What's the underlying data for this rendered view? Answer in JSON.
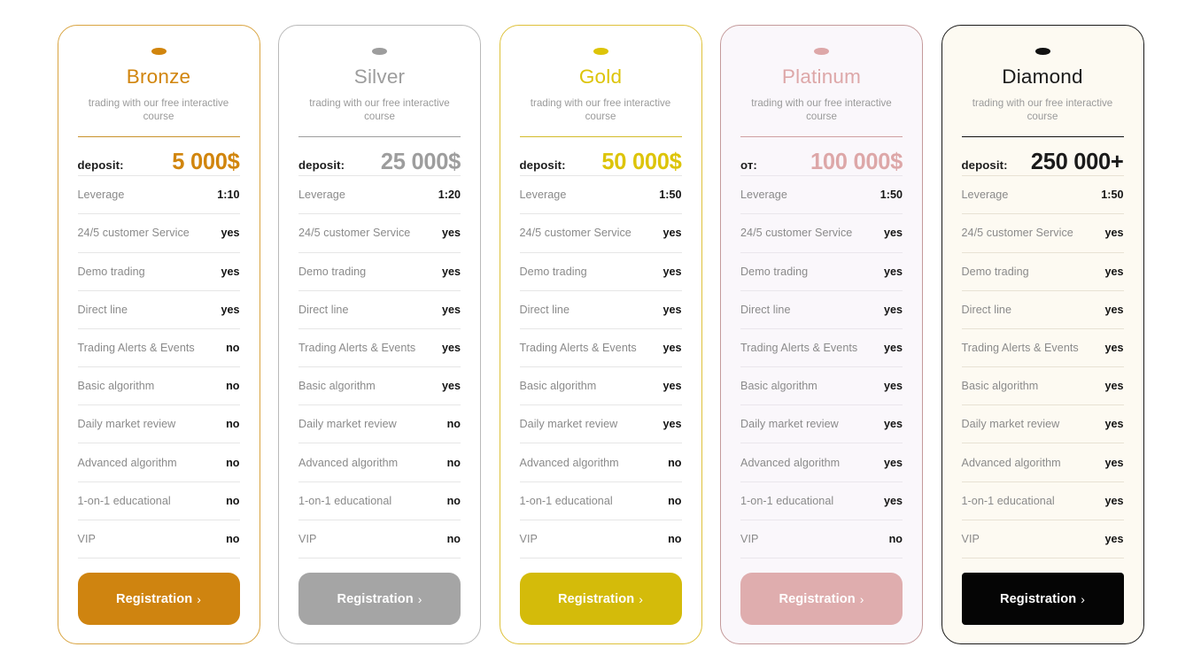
{
  "feature_labels": [
    "Leverage",
    "24/5 customer Service",
    "Demo trading",
    "Direct line",
    "Trading Alerts & Events",
    "Basic algorithm",
    "Daily market review",
    "Advanced algorithm",
    "1-on-1 educational",
    "VIP"
  ],
  "cta": {
    "label": "Registration",
    "chevron": "›",
    "chevron_icon_name": "chevron-right-icon"
  },
  "plans": [
    {
      "id": "bronze",
      "name": "Bronze",
      "tagline": "trading with our free interactive course",
      "accent": "#d1850d",
      "deposit_label": "deposit:",
      "deposit_value": "5 000$",
      "features": [
        "1:10",
        "yes",
        "yes",
        "yes",
        "no",
        "no",
        "no",
        "no",
        "no",
        "no"
      ]
    },
    {
      "id": "silver",
      "name": "Silver",
      "tagline": "trading with our free interactive course",
      "accent": "#9d9d9d",
      "deposit_label": "deposit:",
      "deposit_value": "25 000$",
      "features": [
        "1:20",
        "yes",
        "yes",
        "yes",
        "yes",
        "yes",
        "no",
        "no",
        "no",
        "no"
      ]
    },
    {
      "id": "gold",
      "name": "Gold",
      "tagline": "trading with our free interactive course",
      "accent": "#ddc409",
      "deposit_label": "deposit:",
      "deposit_value": "50 000$",
      "features": [
        "1:50",
        "yes",
        "yes",
        "yes",
        "yes",
        "yes",
        "yes",
        "no",
        "no",
        "no"
      ]
    },
    {
      "id": "platinum",
      "name": "Platinum",
      "tagline": "trading with our free interactive course",
      "accent": "#dda7a8",
      "deposit_label": "от:",
      "deposit_value": "100 000$",
      "features": [
        "1:50",
        "yes",
        "yes",
        "yes",
        "yes",
        "yes",
        "yes",
        "yes",
        "yes",
        "no"
      ]
    },
    {
      "id": "diamond",
      "name": "Diamond",
      "tagline": "trading with our free interactive course",
      "accent": "#1a1a1a",
      "deposit_label": "deposit:",
      "deposit_value": "250 000+",
      "features": [
        "1:50",
        "yes",
        "yes",
        "yes",
        "yes",
        "yes",
        "yes",
        "yes",
        "yes",
        "yes"
      ]
    }
  ]
}
